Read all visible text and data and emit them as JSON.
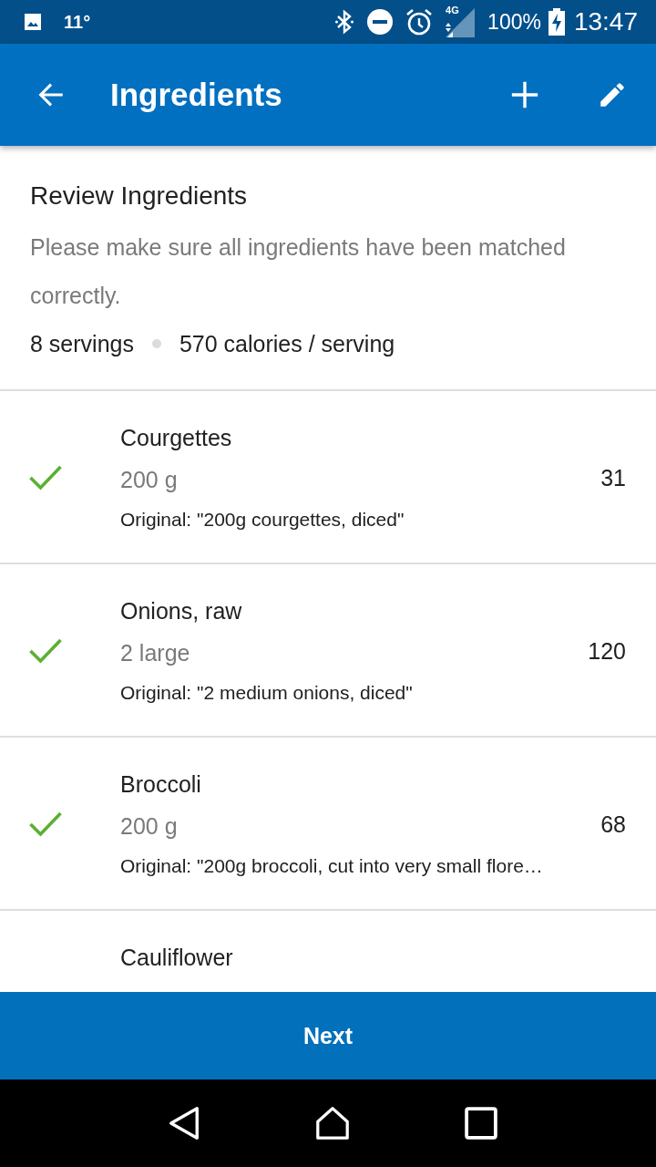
{
  "status_bar": {
    "temperature": "11°",
    "network": "4G",
    "battery": "100%",
    "time": "13:47"
  },
  "app_bar": {
    "title": "Ingredients"
  },
  "summary": {
    "title": "Review Ingredients",
    "description": "Please make sure all ingredients have been matched correctly.",
    "servings": "8 servings",
    "calories": "570 calories / serving"
  },
  "ingredients": [
    {
      "name": "Courgettes",
      "amount": "200 g",
      "original": "Original: \"200g courgettes, diced\"",
      "calories": "31",
      "matched": true
    },
    {
      "name": "Onions, raw",
      "amount": "2 large",
      "original": "Original: \"2 medium onions, diced\"",
      "calories": "120",
      "matched": true
    },
    {
      "name": "Broccoli",
      "amount": "200 g",
      "original": "Original: \"200g broccoli, cut into very small flore…",
      "calories": "68",
      "matched": true
    },
    {
      "name": "Cauliflower"
    }
  ],
  "next_button": {
    "label": "Next"
  }
}
